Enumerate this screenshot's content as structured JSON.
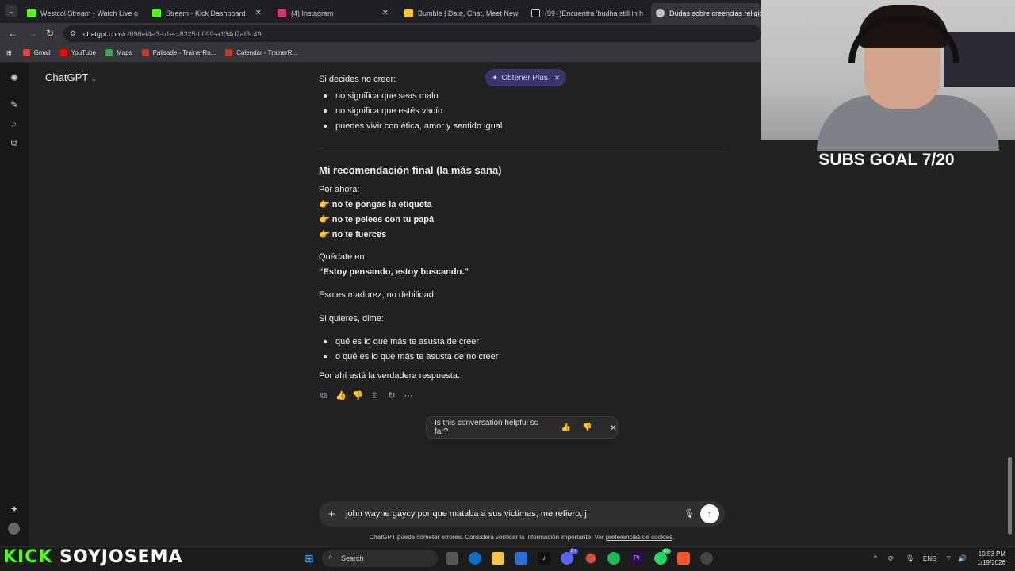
{
  "browser": {
    "tabs": [
      {
        "label": "Westcol Stream - Watch Live o",
        "color": "#53fc18"
      },
      {
        "label": "Stream - Kick Dashboard",
        "color": "#53fc18"
      },
      {
        "label": "(4) Instagram",
        "color": "#e1306c"
      },
      {
        "label": "Bumble | Date, Chat, Meet New",
        "color": "#ffc629"
      },
      {
        "label": "(99+)Encuentra 'budha still in h",
        "color": "#ffffff"
      },
      {
        "label": "Dudas sobre creencias religios",
        "color": "#c0c0c0"
      }
    ],
    "url_domain": "chatgpt.com",
    "url_path": "/c/696ef4e3-b1ec-8325-b099-a134d7af3c49",
    "bookmarks": [
      {
        "label": "Gmail",
        "color": "#ea4335"
      },
      {
        "label": "YouTube",
        "color": "#ff0000"
      },
      {
        "label": "Maps",
        "color": "#34a853"
      },
      {
        "label": "Palisade - TrainerRo...",
        "color": "#c0392b"
      },
      {
        "label": "Calendar - TrainerR...",
        "color": "#c0392b"
      }
    ]
  },
  "chat": {
    "model": "ChatGPT",
    "upsell": "Obtener Plus",
    "intro": "Si decides no creer:",
    "bullets1": [
      "no significa que seas malo",
      "no significa que estés vacío",
      "puedes vivir con ética, amor y sentido igual"
    ],
    "heading": "Mi recomendación final (la más sana)",
    "por_ahora": "Por ahora:",
    "recs": [
      "no te pongas la etiqueta",
      "no te pelees con tu papá",
      "no te fuerces"
    ],
    "quedate": "Quédate en:",
    "quote": "“Estoy pensando, estoy buscando.”",
    "madurez": "Eso es madurez, no debilidad.",
    "si_quieres": "Si quieres, dime:",
    "bullets2": [
      "qué es lo que más te asusta de creer",
      "o qué es lo que más te asusta de no creer"
    ],
    "closing": "Por ahí está la verdadera respuesta.",
    "feedback_question": "Is this conversation helpful so far?",
    "prompt_text": "john wayne gaycy por que mataba a sus victimas, me refiero, j",
    "disclaimer": "ChatGPT puede cometer errores. Considera verificar la información importante. Ver",
    "disclaimer_link": "preferencias de cookies",
    "disclaimer_end": "."
  },
  "overlay": {
    "subs_goal": "SUBS GOAL 7/20",
    "channel_kick": "KICK",
    "channel_name": "SOYJOSEMA"
  },
  "taskbar": {
    "search": "Search",
    "lang": "ENG",
    "time": "10:53 PM",
    "date": "1/19/2026",
    "badge1": "9+",
    "badge2": "60"
  }
}
